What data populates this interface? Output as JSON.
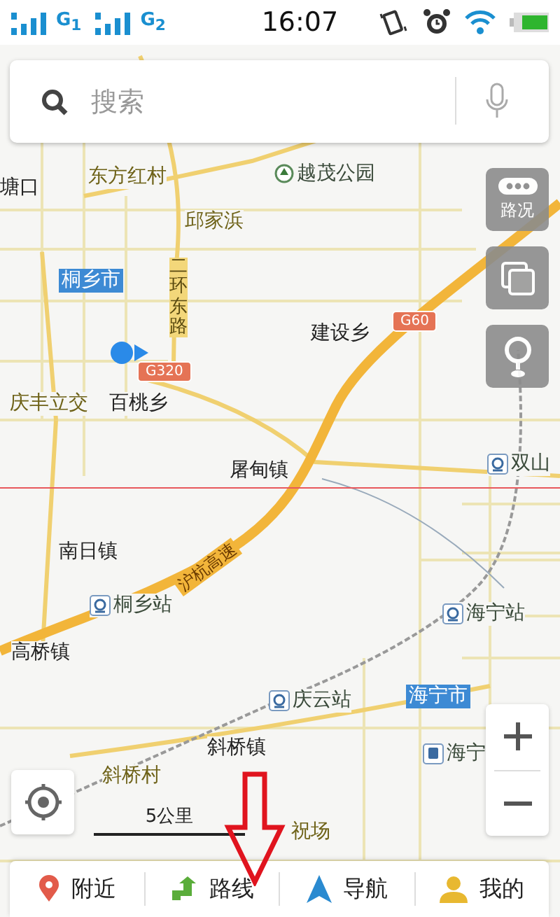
{
  "status_bar": {
    "sims": [
      {
        "network": "G$_{1}$"
      },
      {
        "network": "G$_{2}$"
      }
    ],
    "time": "16:07"
  },
  "search": {
    "placeholder": "搜索"
  },
  "map": {
    "labels": [
      {
        "text": "塘口",
        "kind": "town"
      },
      {
        "text": "东方红村",
        "kind": "village"
      },
      {
        "text": "越茂公园",
        "kind": "park"
      },
      {
        "text": "邱家浜",
        "kind": "village"
      },
      {
        "text": "桐乡市",
        "kind": "city"
      },
      {
        "text": "二环东路",
        "kind": "vertical"
      },
      {
        "text": "建设乡",
        "kind": "town"
      },
      {
        "text": "庆丰立交",
        "kind": "village"
      },
      {
        "text": "百桃乡",
        "kind": "town"
      },
      {
        "text": "屠甸镇",
        "kind": "town"
      },
      {
        "text": "双山",
        "kind": "station"
      },
      {
        "text": "南日镇",
        "kind": "town"
      },
      {
        "text": "沪杭高速",
        "kind": "road"
      },
      {
        "text": "桐乡站",
        "kind": "station"
      },
      {
        "text": "高桥镇",
        "kind": "town"
      },
      {
        "text": "海宁站",
        "kind": "station"
      },
      {
        "text": "庆云站",
        "kind": "station"
      },
      {
        "text": "海宁市",
        "kind": "city"
      },
      {
        "text": "斜桥镇",
        "kind": "town"
      },
      {
        "text": "海宁",
        "kind": "bus"
      },
      {
        "text": "斜桥村",
        "kind": "village"
      },
      {
        "text": "祝场",
        "kind": "village"
      }
    ],
    "shields": [
      {
        "text": "G60"
      },
      {
        "text": "G320"
      }
    ],
    "scale": "5公里"
  },
  "side_buttons": [
    {
      "kind": "traffic",
      "label": "路况"
    },
    {
      "kind": "layers"
    },
    {
      "kind": "pin"
    }
  ],
  "bottom_nav": [
    {
      "kind": "nearby",
      "label": "附近"
    },
    {
      "kind": "route",
      "label": "路线"
    },
    {
      "kind": "navigate",
      "label": "导航"
    },
    {
      "kind": "me",
      "label": "我的"
    }
  ]
}
